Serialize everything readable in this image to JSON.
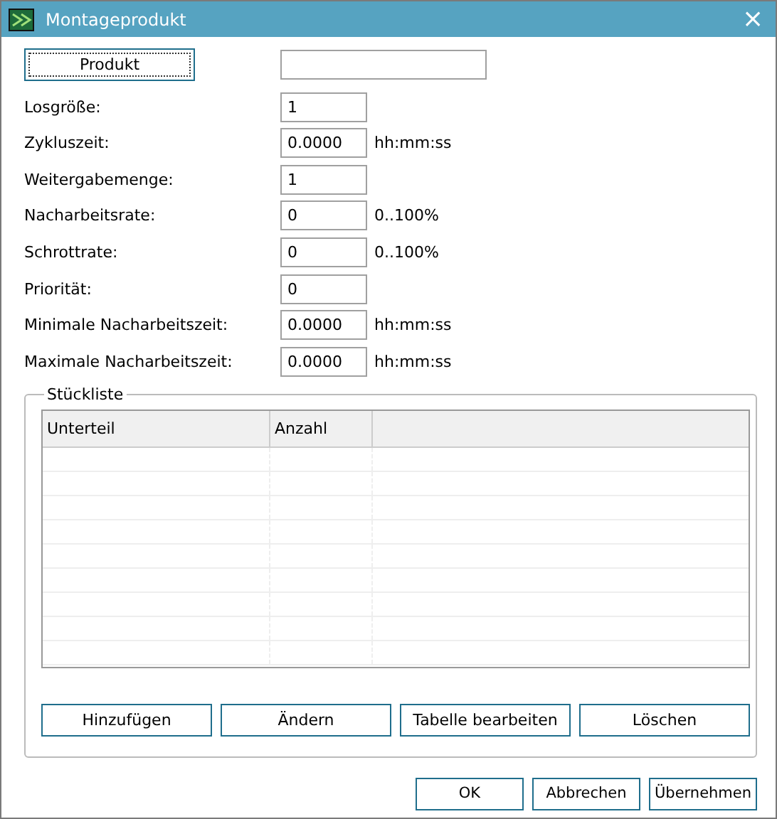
{
  "window": {
    "title": "Montageprodukt",
    "close": "×"
  },
  "product": {
    "button": "Produkt",
    "focused": true
  },
  "fields": [
    {
      "label": "Losgröße:",
      "value": "1"
    },
    {
      "label": "Zykluszeit:",
      "value": "0.0000",
      "unit": "hh:mm:ss"
    },
    {
      "label": "Weitergabemenge:",
      "value": "1"
    },
    {
      "label": "Nacharbeitsrate:",
      "value": "0",
      "unit": "0..100%"
    },
    {
      "label": "Schrottrate:",
      "value": "0",
      "unit": "0..100%"
    },
    {
      "label": "Priorität:",
      "value": "0"
    },
    {
      "label": "Minimale Nacharbeitszeit:",
      "value": "0.0000",
      "unit": "hh:mm:ss"
    },
    {
      "label": "Maximale Nacharbeitszeit:",
      "value": "0.0000",
      "unit": "hh:mm:ss"
    }
  ],
  "bom": {
    "title": "Stückliste",
    "columns": [
      "Unterteil",
      "Anzahl"
    ],
    "buttons": [
      "Hinzufügen",
      "Ändern",
      "Tabelle bearbeiten",
      "Löschen"
    ]
  },
  "buttons": [
    "OK",
    "Abbrechen",
    "Übernehmen"
  ]
}
